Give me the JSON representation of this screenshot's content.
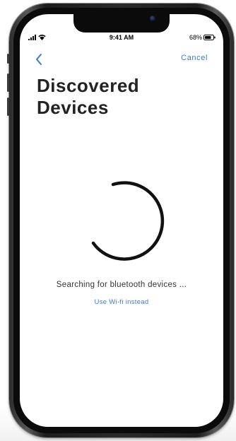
{
  "status_bar": {
    "time": "9:41 AM",
    "battery_percent": "68%",
    "icons": [
      "signal-icon",
      "wifi-icon",
      "battery-icon"
    ]
  },
  "nav": {
    "back_icon": "chevron-left-icon",
    "cancel_label": "Cancel"
  },
  "title": {
    "line1": "Discovered",
    "line2": "Devices"
  },
  "loading": {
    "spinner_icon": "loading-spinner-icon",
    "message": "Searching for bluetooth devices ...",
    "alt_action_label": "Use Wi-fi instead"
  },
  "colors": {
    "accent": "#3d7bd1",
    "title": "#222222",
    "body_text": "#333333",
    "spinner": "#111111",
    "background": "#ffffff",
    "phone_frame": "#2a2a2a"
  }
}
